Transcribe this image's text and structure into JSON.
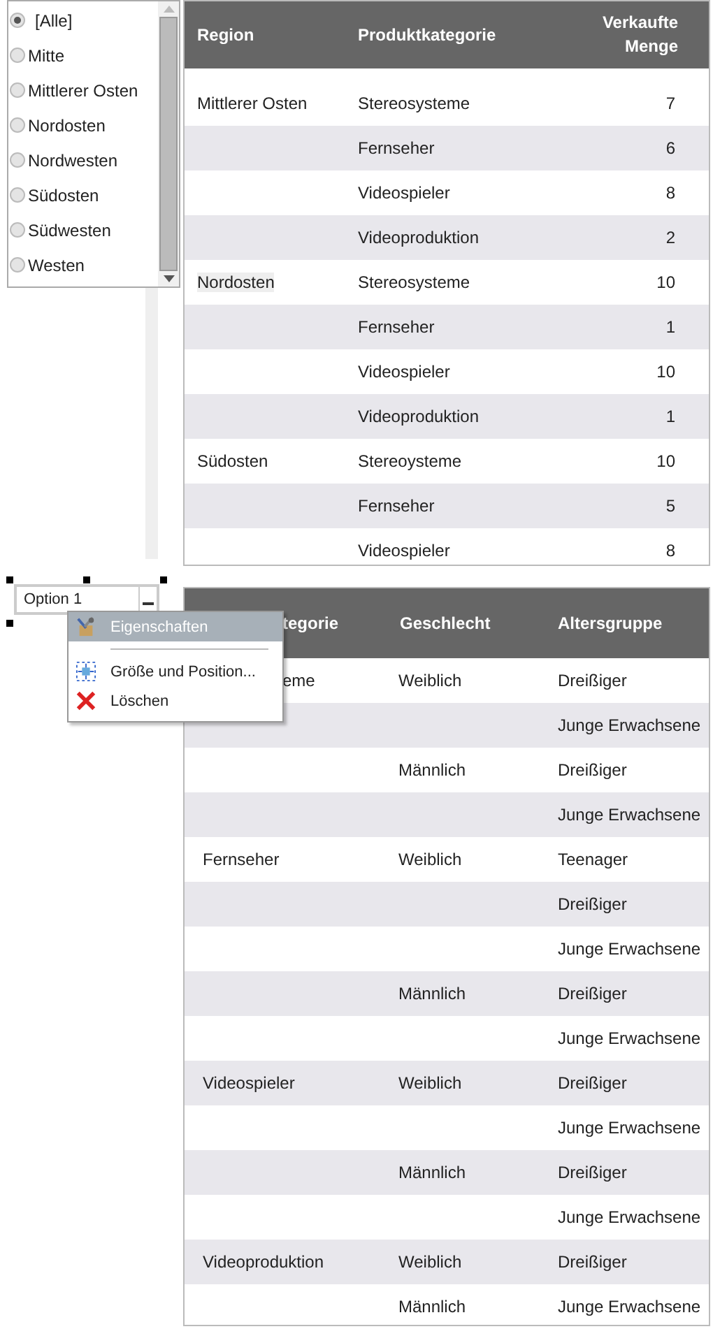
{
  "region_list": {
    "items": [
      {
        "label": "[Alle]",
        "selected": true
      },
      {
        "label": "Mitte",
        "selected": false
      },
      {
        "label": "Mittlerer Osten",
        "selected": false
      },
      {
        "label": "Nordosten",
        "selected": false
      },
      {
        "label": "Nordwesten",
        "selected": false
      },
      {
        "label": "Südosten",
        "selected": false
      },
      {
        "label": "Südwesten",
        "selected": false
      },
      {
        "label": "Westen",
        "selected": false
      }
    ]
  },
  "sales_table": {
    "columns": [
      "Region",
      "Produktkategorie",
      "Verkaufte Menge"
    ],
    "rows": [
      {
        "region": "Mittlerer Osten",
        "category": "Stereosysteme",
        "quantity": "7"
      },
      {
        "category": "Fernseher",
        "quantity": "6"
      },
      {
        "category": "Videospieler",
        "quantity": "8"
      },
      {
        "category": "Videoproduktion",
        "quantity": "2"
      },
      {
        "region": "Nordosten",
        "category": "Stereosysteme",
        "quantity": "10"
      },
      {
        "category": "Fernseher",
        "quantity": "1"
      },
      {
        "category": "Videospieler",
        "quantity": "10"
      },
      {
        "category": "Videoproduktion",
        "quantity": "1"
      },
      {
        "region": "Südosten",
        "category": "Stereoysteme",
        "quantity": "10"
      },
      {
        "category": "Fernseher",
        "quantity": "5"
      },
      {
        "category": "Videospieler",
        "quantity": "8"
      }
    ]
  },
  "option_control": {
    "value": "Option 1"
  },
  "context_menu": {
    "items": [
      {
        "kind": "item",
        "label": "Eigenschaften",
        "selected": true
      },
      {
        "kind": "separator"
      },
      {
        "kind": "item",
        "label": "Größe und Position...",
        "selected": false
      },
      {
        "kind": "item",
        "label": "Löschen",
        "selected": false
      }
    ]
  },
  "demographics_table": {
    "columns": [
      {
        "label": "tegorie",
        "covered": true
      },
      {
        "label": "Geschlecht"
      },
      {
        "label": "Altersgruppe"
      }
    ],
    "rows": [
      {
        "category": "eme",
        "covered": true,
        "gender": "Weiblich",
        "age": "Dreißiger"
      },
      {
        "age": "Junge Erwachsene"
      },
      {
        "gender": "Männlich",
        "age": "Dreißiger"
      },
      {
        "age": "Junge Erwachsene"
      },
      {
        "category": "Fernseher",
        "gender": "Weiblich",
        "age": "Teenager"
      },
      {
        "age": "Dreißiger"
      },
      {
        "age": "Junge Erwachsene"
      },
      {
        "gender": "Männlich",
        "age": "Dreißiger"
      },
      {
        "age": "Junge Erwachsene"
      },
      {
        "category": "Videospieler",
        "gender": "Weiblich",
        "age": "Dreißiger"
      },
      {
        "age": "Junge Erwachsene"
      },
      {
        "gender": "Männlich",
        "age": "Dreißiger"
      },
      {
        "age": "Junge Erwachsene"
      },
      {
        "category": "Videoproduktion",
        "gender": "Weiblich",
        "age": "Dreißiger"
      },
      {
        "gender": "Männlich",
        "age": "Junge Erwachsene"
      }
    ]
  }
}
